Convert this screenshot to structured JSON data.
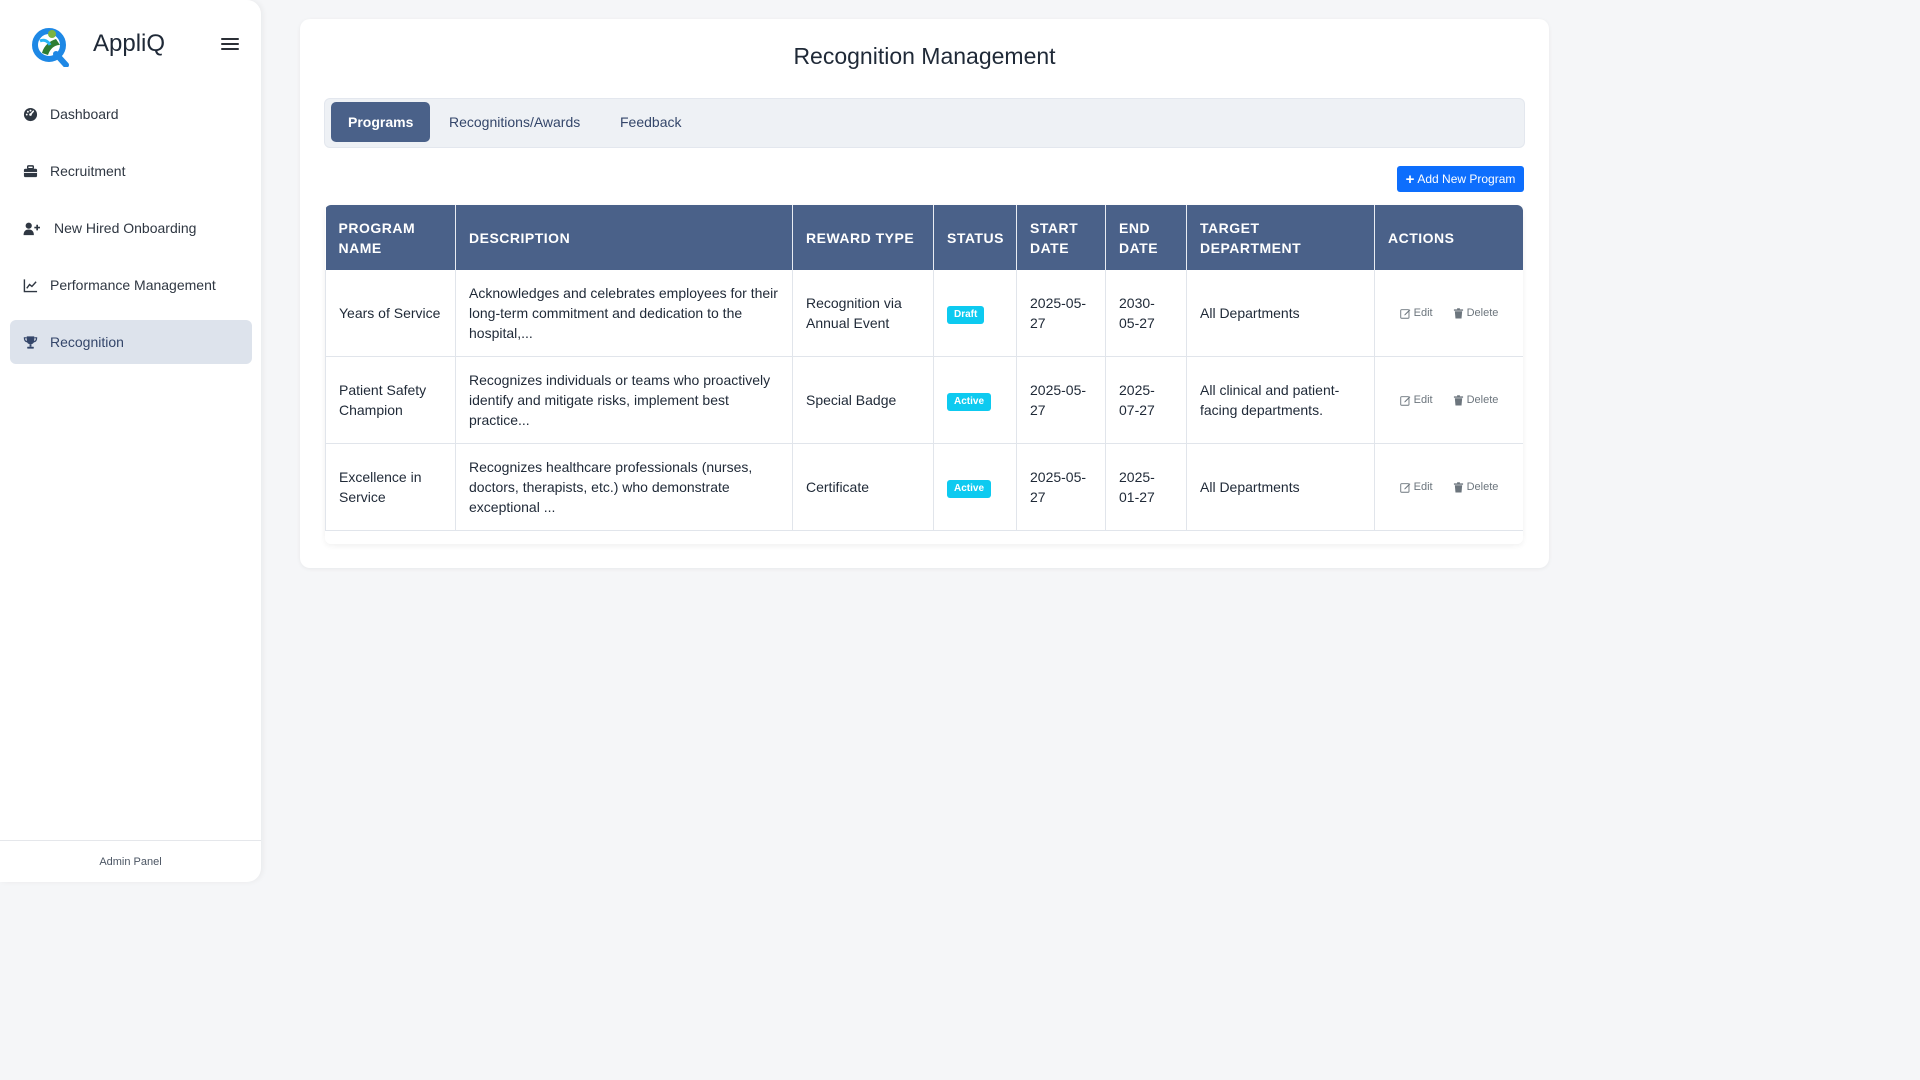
{
  "app": {
    "name": "AppliQ"
  },
  "sidebar": {
    "items": [
      {
        "label": "Dashboard",
        "icon": "dashboard-gauge-icon"
      },
      {
        "label": "Recruitment",
        "icon": "briefcase-icon"
      },
      {
        "label": "New Hired Onboarding",
        "icon": "user-plus-icon"
      },
      {
        "label": "Performance Management",
        "icon": "chart-line-icon"
      },
      {
        "label": "Recognition",
        "icon": "trophy-icon",
        "active": true
      }
    ],
    "footer": "Admin Panel"
  },
  "page": {
    "title": "Recognition Management"
  },
  "tabs": [
    {
      "label": "Programs",
      "active": true
    },
    {
      "label": "Recognitions/Awards"
    },
    {
      "label": "Feedback"
    }
  ],
  "add_button": {
    "label": "Add New Program"
  },
  "table": {
    "columns": [
      "PROGRAM NAME",
      "DESCRIPTION",
      "REWARD TYPE",
      "STATUS",
      "START DATE",
      "END DATE",
      "TARGET DEPARTMENT",
      "ACTIONS"
    ],
    "rows": [
      {
        "name": "Years of Service",
        "description": "Acknowledges and celebrates employees for their long-term commitment and dedication to the hospital,...",
        "reward": "Recognition via Annual Event",
        "status": "Draft",
        "start": "2025-05-27",
        "end": "2030-05-27",
        "department": "All Departments"
      },
      {
        "name": "Patient Safety Champion",
        "description": "Recognizes individuals or teams who proactively identify and mitigate risks, implement best practice...",
        "reward": "Special Badge",
        "status": "Active",
        "start": "2025-05-27",
        "end": "2025-07-27",
        "department": "All clinical and patient-facing departments."
      },
      {
        "name": "Excellence in Service",
        "description": "Recognizes healthcare professionals (nurses, doctors, therapists, etc.) who demonstrate exceptional ...",
        "reward": "Certificate",
        "status": "Active",
        "start": "2025-05-27",
        "end": "2025-01-27",
        "department": "All Departments"
      }
    ],
    "actions": {
      "edit": "Edit",
      "delete": "Delete"
    }
  },
  "colors": {
    "primary": "#4a6189",
    "button": "#0d6efd",
    "badge": "#0dcaf0",
    "active_nav": "#dde3ec"
  }
}
